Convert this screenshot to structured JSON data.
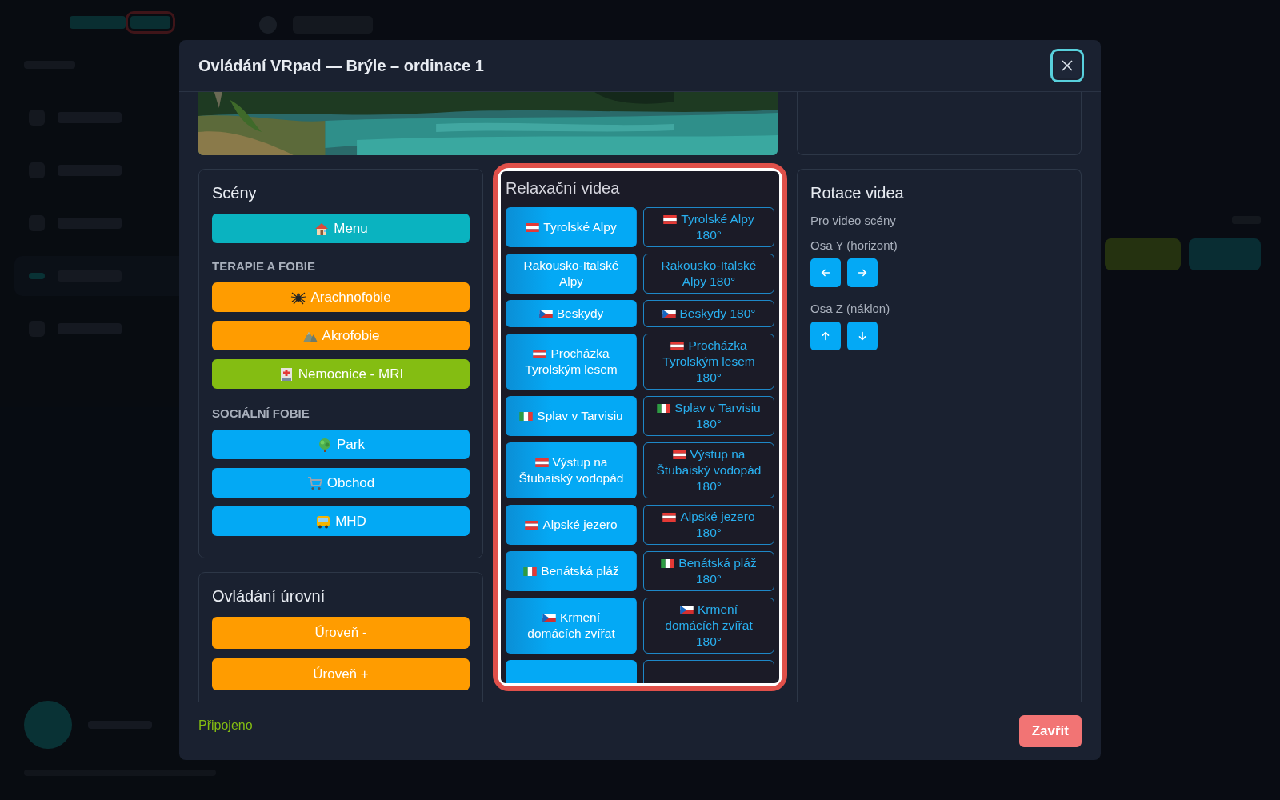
{
  "background": {
    "sidebar_items": [
      {
        "selected": false
      },
      {
        "selected": false
      },
      {
        "selected": false
      },
      {
        "selected": true
      },
      {
        "selected": false
      }
    ]
  },
  "modal": {
    "title": "Ovládání VRpad — Brýle – ordinace 1",
    "scenes": {
      "title": "Scény",
      "items": [
        {
          "kind": "button",
          "label": "Menu",
          "color": "#0ab3c0"
        },
        {
          "kind": "heading",
          "label": "TERAPIE A FOBIE"
        },
        {
          "kind": "button",
          "label": "Arachnofobie",
          "color": "#ff9c00"
        },
        {
          "kind": "button",
          "label": "Akrofobie",
          "color": "#ff9c00"
        },
        {
          "kind": "button",
          "label": "Nemocnice - MRI",
          "color": "#84bd12"
        },
        {
          "kind": "heading",
          "label": "SOCIÁLNÍ FOBIE"
        },
        {
          "kind": "button",
          "label": "Park",
          "color": "#03a9f4"
        },
        {
          "kind": "button",
          "label": "Obchod",
          "color": "#03a9f4"
        },
        {
          "kind": "button",
          "label": "MHD",
          "color": "#03a9f4"
        }
      ]
    },
    "levels": {
      "title": "Ovládání úrovní",
      "buttons": [
        {
          "label": "Úroveň -",
          "color": "#ff9c00"
        },
        {
          "label": "Úroveň +",
          "color": "#ff9c00"
        }
      ]
    },
    "videos": {
      "title": "Relaxační videa",
      "highlighted": true,
      "items": [
        {
          "kind": "filled",
          "label": "Tyrolské Alpy"
        },
        {
          "kind": "outline",
          "label": "Tyrolské Alpy 180°"
        },
        {
          "kind": "filled",
          "label": "Rakousko-Italské Alpy"
        },
        {
          "kind": "outline",
          "label": "Rakousko-Italské Alpy 180°"
        },
        {
          "kind": "filled",
          "label": "Beskydy"
        },
        {
          "kind": "outline",
          "label": "Beskydy 180°"
        },
        {
          "kind": "filled",
          "label": "Procházka Tyrolským lesem"
        },
        {
          "kind": "outline",
          "label": "Procházka Tyrolským lesem 180°"
        },
        {
          "kind": "filled",
          "label": "Splav v Tarvisiu"
        },
        {
          "kind": "outline",
          "label": "Splav v Tarvisiu 180°"
        },
        {
          "kind": "filled",
          "label": "Výstup na Štubaiský vodopád"
        },
        {
          "kind": "outline",
          "label": "Výstup na Štubaiský vodopád 180°"
        },
        {
          "kind": "filled",
          "label": "Alpské jezero"
        },
        {
          "kind": "outline",
          "label": "Alpské jezero 180°"
        },
        {
          "kind": "filled",
          "label": "Benátská pláž"
        },
        {
          "kind": "outline",
          "label": "Benátská pláž 180°"
        },
        {
          "kind": "filled",
          "label": "Krmení domácích zvířat"
        },
        {
          "kind": "outline",
          "label": "Krmení domácích zvířat 180°"
        }
      ]
    },
    "rotation": {
      "title": "Rotace videa",
      "subtitle": "Pro video scény",
      "axes": [
        {
          "label": "Osa Y (horizont)"
        },
        {
          "label": "Osa Z (náklon)"
        }
      ]
    },
    "footer": {
      "status": "Připojeno",
      "close_label": "Zavřít"
    }
  }
}
